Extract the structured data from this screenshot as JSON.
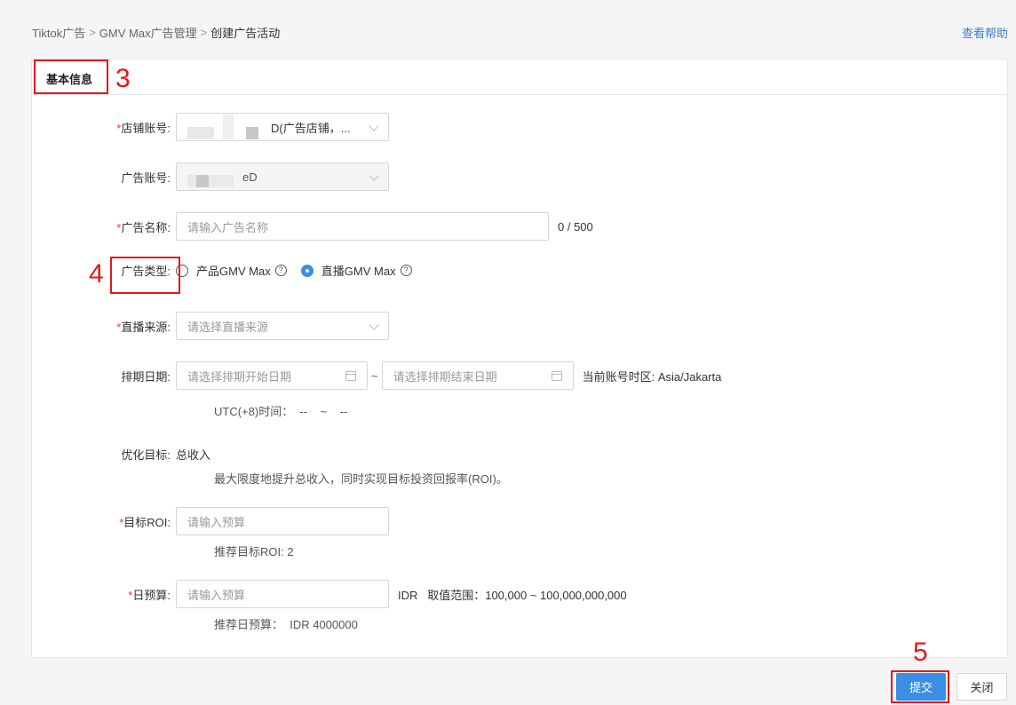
{
  "breadcrumb": {
    "items": [
      "Tiktok广告",
      "GMV Max广告管理",
      "创建广告活动"
    ],
    "separator": ">"
  },
  "help_link": "查看帮助",
  "section_title": "基本信息",
  "fields": {
    "store_account": {
      "label": "店铺账号",
      "required": "*",
      "value_suffix": "D(广告店铺，...",
      "colon": ":"
    },
    "ad_account": {
      "label": "广告账号",
      "value_suffix": "eD",
      "colon": ":"
    },
    "ad_name": {
      "label": "广告名称",
      "required": "*",
      "placeholder": "请输入广告名称",
      "counter": "0 / 500",
      "colon": ":"
    },
    "ad_type": {
      "label": "广告类型",
      "colon": ":",
      "options": [
        "产品GMV Max",
        "直播GMV Max"
      ],
      "selected_index": 1
    },
    "live_source": {
      "label": "直播来源",
      "required": "*",
      "placeholder": "请选择直播来源",
      "colon": ":"
    },
    "schedule": {
      "label": "排期日期",
      "colon": ":",
      "start_placeholder": "请选择排期开始日期",
      "end_placeholder": "请选择排期结束日期",
      "range_sep": "~",
      "timezone": "当前账号时区: Asia/Jakarta",
      "utc_line": "UTC(+8)时间：  --    ~    --"
    },
    "goal": {
      "label": "优化目标",
      "colon": ":",
      "value": "总收入",
      "description": "最大限度地提升总收入，同时实现目标投资回报率(ROI)。"
    },
    "target_roi": {
      "label": "目标ROI",
      "required": "*",
      "colon": ":",
      "placeholder": "请输入预算",
      "recommend": "推荐目标ROI: 2"
    },
    "daily_budget": {
      "label": "日预算",
      "required": "*",
      "colon": ":",
      "placeholder": "请输入预算",
      "currency_range": "IDR   取值范围：100,000 ~ 100,000,000,000",
      "recommend": "推荐日预算：  IDR 4000000"
    }
  },
  "annotations": [
    "3",
    "4",
    "5"
  ],
  "buttons": {
    "submit": "提交",
    "close": "关闭"
  },
  "colors": {
    "accent": "#3a8ee6",
    "required": "#e4393c",
    "annotation": "#e0191e",
    "link": "#3a7fc4"
  }
}
